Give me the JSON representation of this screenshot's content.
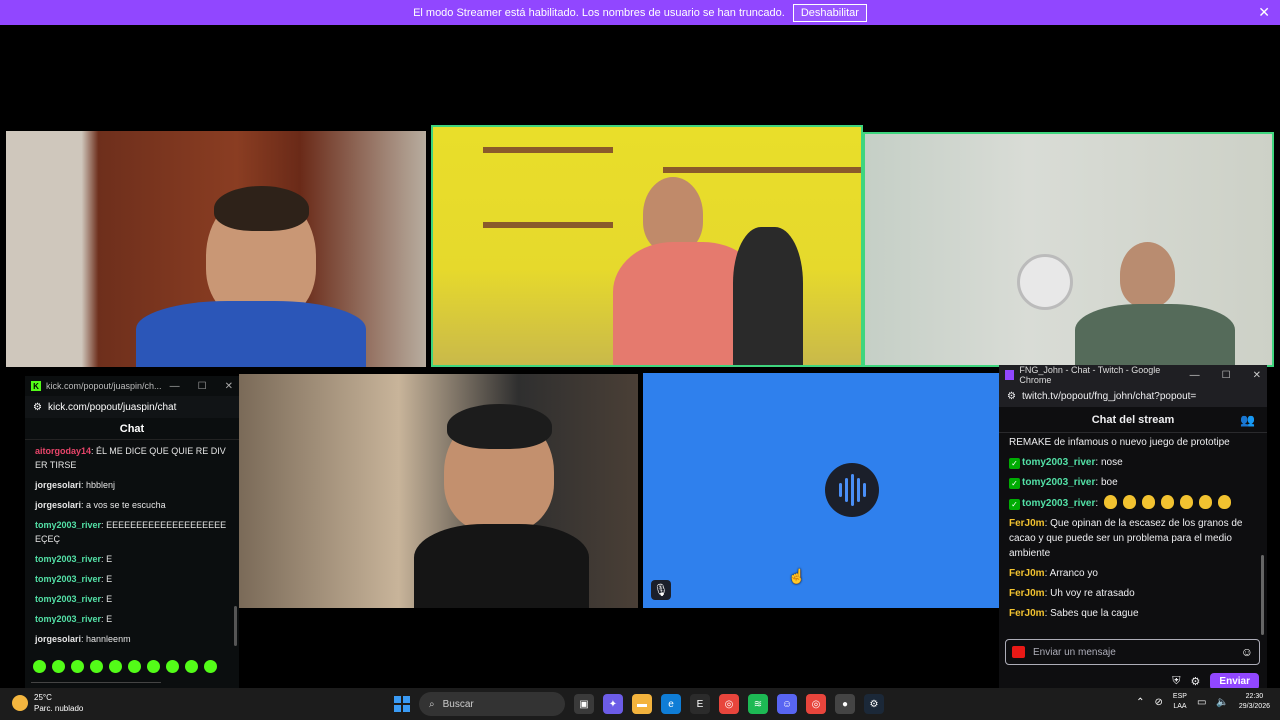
{
  "banner": {
    "text": "El modo Streamer está habilitado. Los nombres de usuario se han truncado.",
    "button": "Deshabilitar"
  },
  "kick": {
    "window_title": "kick.com/popout/juaspin/ch...",
    "url": "kick.com/popout/juaspin/chat",
    "chat_title": "Chat",
    "messages": [
      {
        "user": "aitorgoday14",
        "text": "ÉL ME DICE QUE QUIE RE DIVER TIRSE"
      },
      {
        "user": "jorgesolari",
        "text": "hbblenj"
      },
      {
        "user": "jorgesolari",
        "text": "a vos se te escucha"
      },
      {
        "user": "tomy2003_river",
        "text": "EEEEEEEEEEEEEEEEEEEEEÇEÇ"
      },
      {
        "user": "tomy2003_river",
        "text": "E"
      },
      {
        "user": "tomy2003_river",
        "text": "E"
      },
      {
        "user": "tomy2003_river",
        "text": "E"
      },
      {
        "user": "tomy2003_river",
        "text": "E"
      },
      {
        "user": "jorgesolari",
        "text": "hannleenm"
      }
    ]
  },
  "twitch": {
    "window_title": "FNG_John - Chat - Twitch - Google Chrome",
    "url": "twitch.tv/popout/fng_john/chat?popout=",
    "chat_title": "Chat del stream",
    "messages": [
      {
        "user": "",
        "text": "REMAKE de infamous o nuevo juego de prototipe"
      },
      {
        "user": "tomy2003_river",
        "text": "nose"
      },
      {
        "user": "tomy2003_river",
        "text": "boe"
      },
      {
        "user": "tomy2003_river",
        "text": ""
      },
      {
        "user": "FerJ0m",
        "text": "Que opinan de la escasez de los granos de cacao y que puede ser un problema para el medio ambiente"
      },
      {
        "user": "FerJ0m",
        "text": "Arranco yo"
      },
      {
        "user": "FerJ0m",
        "text": "Uh voy re atrasado"
      },
      {
        "user": "FerJ0m",
        "text": "Sabes que la cague"
      }
    ],
    "input_placeholder": "Enviar un mensaje",
    "send_label": "Enviar"
  },
  "taskbar": {
    "weather_temp": "25°C",
    "weather_desc": "Parc. nublado",
    "search_placeholder": "Buscar",
    "lang_1": "ESP",
    "lang_2": "LAA",
    "time": "22:30",
    "date": "29/3/2026"
  },
  "colors": {
    "twitch_purple": "#9147ff",
    "kick_green": "#53fc18",
    "active_speaker": "#3fd57e",
    "audio_tile_blue": "#2f80ed"
  }
}
